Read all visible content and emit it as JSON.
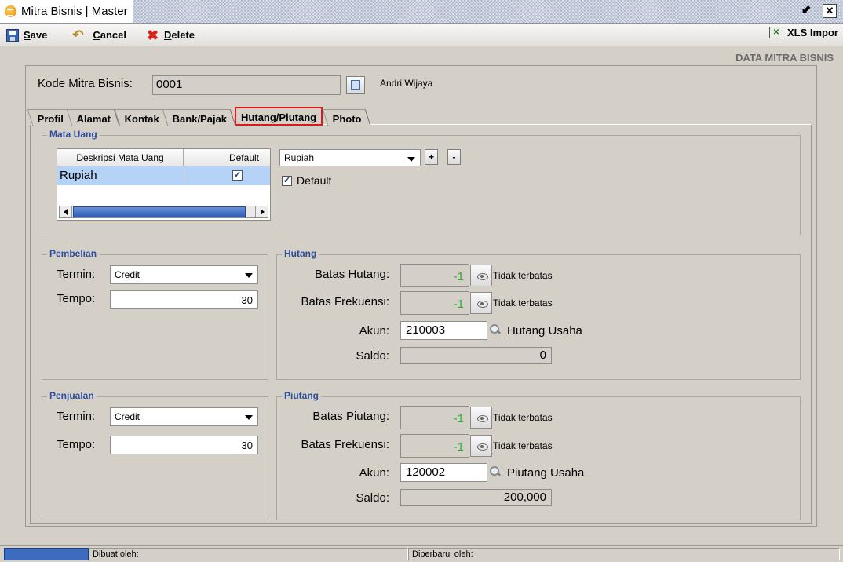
{
  "window": {
    "title": "Mitra Bisnis | Master"
  },
  "toolbar": {
    "save_label": "Save",
    "cancel_label": "Cancel",
    "delete_label": "Delete",
    "xls_label": "XLS Impor"
  },
  "header": {
    "section_title": "DATA MITRA BISNIS"
  },
  "kode": {
    "label": "Kode Mitra Bisnis:",
    "value": "0001",
    "name": "Andri Wijaya"
  },
  "tabs": [
    {
      "label": "Profil"
    },
    {
      "label": "Alamat"
    },
    {
      "label": "Kontak"
    },
    {
      "label": "Bank/Pajak"
    },
    {
      "label": "Hutang/Piutang",
      "active": true
    },
    {
      "label": "Photo"
    }
  ],
  "mata_uang": {
    "legend": "Mata Uang",
    "columns": [
      "Deskripsi Mata Uang",
      "Default"
    ],
    "rows": [
      {
        "deskripsi": "Rupiah",
        "default": "✓"
      }
    ],
    "selected_currency": "Rupiah",
    "add_label": "+",
    "remove_label": "-",
    "default_check": "✓",
    "default_label": "Default"
  },
  "pembelian": {
    "legend": "Pembelian",
    "termin_label": "Termin:",
    "termin_value": "Credit",
    "tempo_label": "Tempo:",
    "tempo_value": "30"
  },
  "hutang": {
    "legend": "Hutang",
    "batas_label": "Batas Hutang:",
    "batas_value": "-1",
    "batas_note": "Tidak terbatas",
    "frek_label": "Batas Frekuensi:",
    "frek_value": "-1",
    "frek_note": "Tidak terbatas",
    "akun_label": "Akun:",
    "akun_value": "210003",
    "akun_desc": "Hutang Usaha",
    "saldo_label": "Saldo:",
    "saldo_value": "0"
  },
  "penjualan": {
    "legend": "Penjualan",
    "termin_label": "Termin:",
    "termin_value": "Credit",
    "tempo_label": "Tempo:",
    "tempo_value": "30"
  },
  "piutang": {
    "legend": "Piutang",
    "batas_label": "Batas Piutang:",
    "batas_value": "-1",
    "batas_note": "Tidak terbatas",
    "frek_label": "Batas Frekuensi:",
    "frek_value": "-1",
    "frek_note": "Tidak terbatas",
    "akun_label": "Akun:",
    "akun_value": "120002",
    "akun_desc": "Piutang Usaha",
    "saldo_label": "Saldo:",
    "saldo_value": "200,000"
  },
  "status": {
    "created_label": "Dibuat oleh:",
    "updated_label": "Diperbarui oleh:"
  },
  "colors": {
    "accent_blue": "#2d4d9b",
    "highlight_red": "#e0171b",
    "row_selected": "#b5d3f7",
    "value_green": "#2bb02b"
  }
}
